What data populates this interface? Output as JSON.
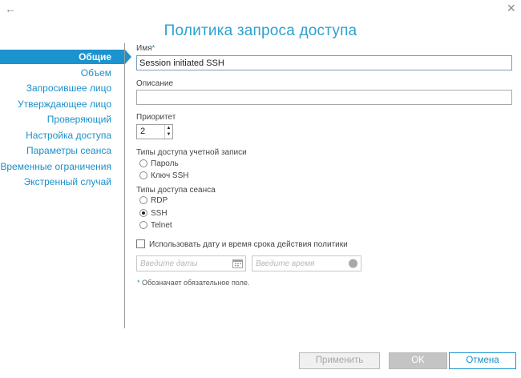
{
  "window": {
    "title": "Политика запроса доступа",
    "back_glyph": "←",
    "close_glyph": "✕"
  },
  "sidebar": {
    "items": [
      {
        "label": "Общие",
        "active": true
      },
      {
        "label": "Объем"
      },
      {
        "label": "Запросившее лицо"
      },
      {
        "label": "Утверждающее лицо"
      },
      {
        "label": "Проверяющий"
      },
      {
        "label": "Настройка доступа"
      },
      {
        "label": "Параметры сеанса"
      },
      {
        "label": "Временные ограничения"
      },
      {
        "label": "Экстренный случай"
      }
    ]
  },
  "form": {
    "name_label": "Имя",
    "required_mark": "*",
    "name_value": "Session initiated SSH",
    "description_label": "Описание",
    "description_value": "",
    "priority_label": "Приоритет",
    "priority_value": "2",
    "account_access_label": "Типы доступа учетной записи",
    "account_access_options": [
      {
        "label": "Пароль",
        "checked": false
      },
      {
        "label": "Ключ SSH",
        "checked": false
      }
    ],
    "session_access_label": "Типы доступа сеанса",
    "session_access_options": [
      {
        "label": "RDP",
        "checked": false
      },
      {
        "label": "SSH",
        "checked": true
      },
      {
        "label": "Telnet",
        "checked": false
      }
    ],
    "use_dates_label": "Использовать дату и время срока действия политики",
    "use_dates_checked": false,
    "date_placeholder": "Введите даты",
    "time_placeholder": "Введите время",
    "required_note": "Обозначает обязательное поле."
  },
  "buttons": {
    "apply": "Применить",
    "ok": "OK",
    "cancel": "Отмена"
  },
  "colors": {
    "accent": "#1b93cf",
    "title": "#2ea0cf"
  }
}
